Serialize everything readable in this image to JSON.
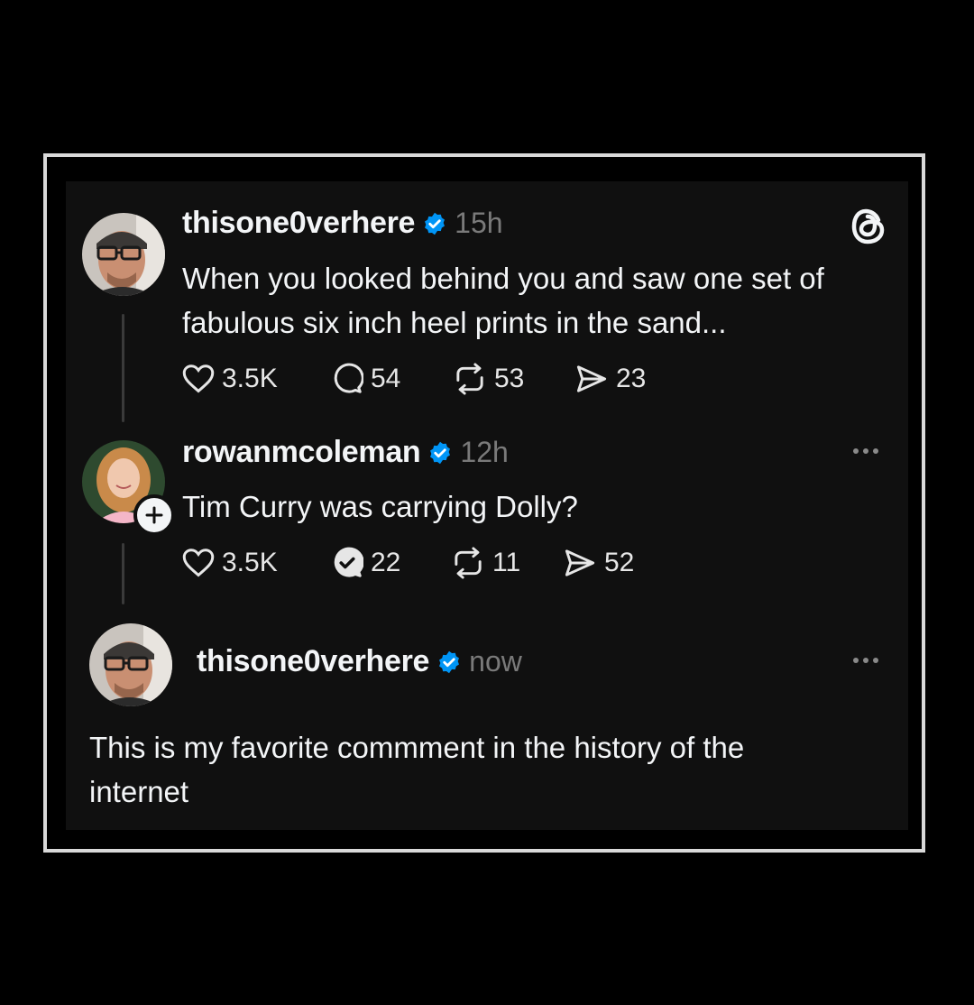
{
  "posts": [
    {
      "username": "thisone0verhere",
      "time": "15h",
      "text_line1": "When you looked behind you and saw one set of",
      "text_line2": "fabulous six inch heel prints in the sand...",
      "likes": "3.5K",
      "replies": "54",
      "reposts": "53",
      "shares": "23"
    },
    {
      "username": "rowanmcoleman",
      "time": "12h",
      "text": "Tim Curry was carrying Dolly?",
      "likes": "3.5K",
      "replies": "22",
      "reposts": "11",
      "shares": "52"
    },
    {
      "username": "thisone0verhere",
      "time": "now",
      "text_line1": "This is my favorite commment in the history of the",
      "text_line2": "internet"
    }
  ],
  "icons": {
    "app_logo": "threads-logo-icon",
    "verified": "verified-badge-icon",
    "like": "heart-icon",
    "reply": "comment-icon",
    "repost": "repost-icon",
    "share": "send-icon",
    "more": "more-dots-icon",
    "follow": "plus-icon"
  },
  "colors": {
    "background": "#000000",
    "card": "#101010",
    "verified": "#0095f6",
    "muted": "#7a7a7a",
    "text": "#f3f5f7"
  }
}
